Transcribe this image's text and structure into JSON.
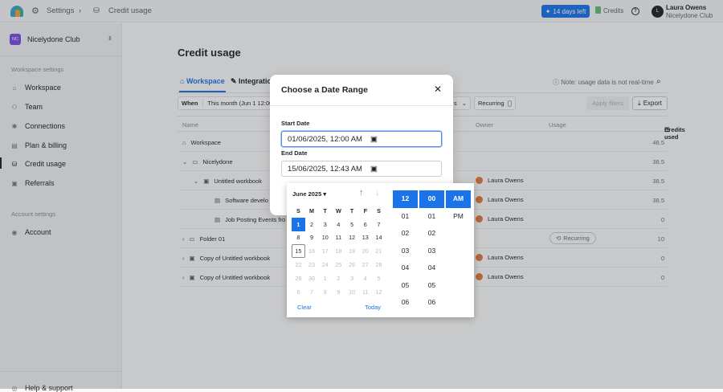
{
  "topbar": {
    "settings": "Settings",
    "current": "Credit usage",
    "trial": "14 days left",
    "credits": "Credits",
    "user_name": "Laura Owens",
    "user_org": "Nicelydone Club",
    "avatar_letter": "L"
  },
  "sidebar": {
    "org_initials": "NC",
    "org_name": "Nicelydone Club",
    "workspace_heading": "Workspace settings",
    "items": [
      {
        "label": "Workspace",
        "icon": "home-icon"
      },
      {
        "label": "Team",
        "icon": "team-icon"
      },
      {
        "label": "Connections",
        "icon": "plug-icon"
      },
      {
        "label": "Plan & billing",
        "icon": "card-icon"
      },
      {
        "label": "Credit usage",
        "icon": "coin-icon"
      },
      {
        "label": "Referrals",
        "icon": "gift-icon"
      }
    ],
    "account_heading": "Account settings",
    "account": "Account",
    "help": "Help & support"
  },
  "main": {
    "title": "Credit usage",
    "tabs": [
      "Workspace",
      "Integrations"
    ],
    "note": "Note: usage data is not real-time",
    "filters": {
      "when_label": "When",
      "when_value": "This month (Jun 1 12:00 AM",
      "partial": "s",
      "recurring": "Recurring",
      "apply": "Apply filters",
      "export": "Export"
    },
    "columns": {
      "name": "Name",
      "owner": "Owner",
      "usage": "Usage",
      "credits": "Credits used"
    },
    "rows": [
      {
        "name": "Workspace",
        "owner": "",
        "usage": "",
        "credits": "48.5"
      },
      {
        "name": "Nicelydone",
        "owner": "",
        "usage": "",
        "credits": "38.5"
      },
      {
        "name": "Untitled workbook",
        "owner": "Laura Owens",
        "usage": "",
        "credits": "38.5"
      },
      {
        "name": "Software develo",
        "owner": "Laura Owens",
        "usage": "",
        "credits": "38.5"
      },
      {
        "name": "Job Posting Events fro",
        "owner": "Laura Owens",
        "usage": "",
        "credits": "0"
      },
      {
        "name": "Folder 01",
        "owner": "",
        "usage": "Recurring",
        "credits": "10"
      },
      {
        "name": "Copy of Untitled workbook",
        "owner": "Laura Owens",
        "usage": "",
        "credits": "0"
      },
      {
        "name": "Copy of Untitled workbook",
        "owner": "Laura Owens",
        "usage": "",
        "credits": "0"
      }
    ]
  },
  "modal": {
    "title": "Choose a Date Range",
    "start_label": "Start Date",
    "start_value": "01/06/2025, 12:00 AM",
    "end_label": "End Date",
    "end_value": "15/06/2025, 12:43 AM"
  },
  "picker": {
    "month": "June 2025",
    "weekdays": [
      "S",
      "M",
      "T",
      "W",
      "T",
      "F",
      "S"
    ],
    "days": [
      "1",
      "2",
      "3",
      "4",
      "5",
      "6",
      "7",
      "8",
      "9",
      "10",
      "11",
      "12",
      "13",
      "14",
      "15",
      "16",
      "17",
      "18",
      "19",
      "20",
      "21",
      "22",
      "23",
      "24",
      "25",
      "26",
      "27",
      "28",
      "29",
      "30",
      "1",
      "2",
      "3",
      "4",
      "5",
      "6",
      "7",
      "8",
      "9",
      "10",
      "11",
      "12"
    ],
    "clear": "Clear",
    "today": "Today",
    "hours": [
      "12",
      "01",
      "02",
      "03",
      "04",
      "05",
      "06"
    ],
    "minutes": [
      "00",
      "01",
      "02",
      "03",
      "04",
      "05",
      "06"
    ],
    "ampm": [
      "AM",
      "PM"
    ]
  }
}
